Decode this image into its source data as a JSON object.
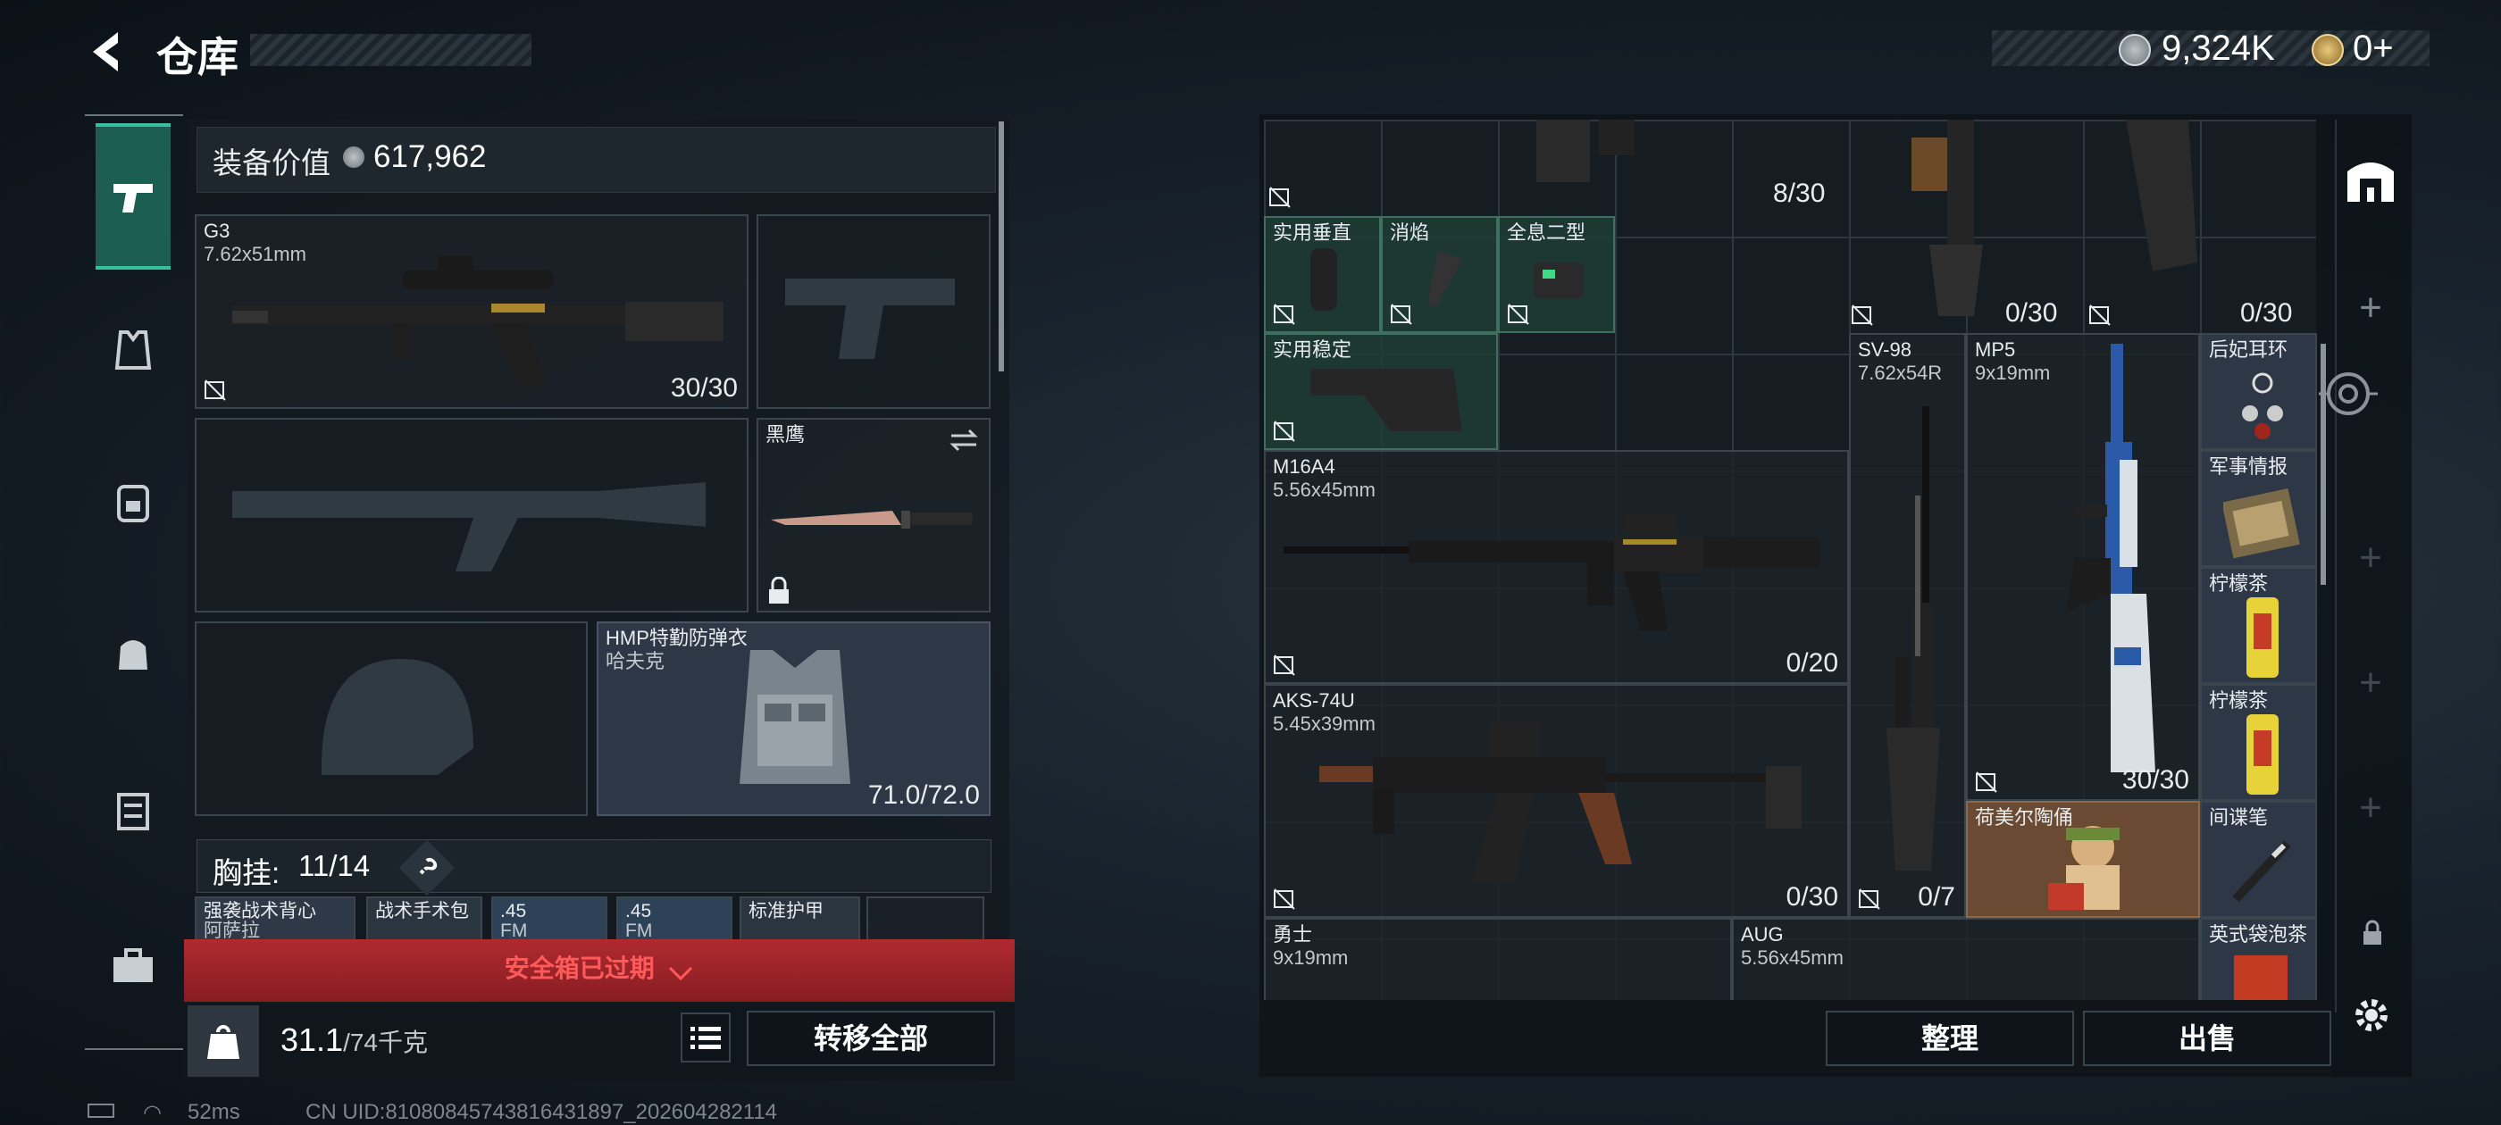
{
  "header": {
    "title": "仓库",
    "currency": "9,324K",
    "coins": "0+"
  },
  "equipment": {
    "value_label": "装备价值",
    "value": "617,962",
    "primary": {
      "name": "G3",
      "caliber": "7.62x51mm",
      "ammo": "30/30"
    },
    "melee": {
      "name": "黑鹰"
    },
    "armor": {
      "name": "HMP特勤防弹衣",
      "sub": "哈夫克",
      "durability": "71.0/72.0"
    },
    "chest": {
      "label": "胸挂:",
      "count": "11/14",
      "help": "?"
    },
    "chest_items": [
      "强袭战术背心",
      "战术手术包",
      ".45",
      ".45",
      "标准护甲"
    ],
    "chest_items_sub": [
      "阿萨拉",
      "",
      "FM",
      "FM",
      ""
    ],
    "safebox": "安全箱已过期",
    "weight": "31.1",
    "weight_max": "/74千克",
    "transfer_all": "转移全部"
  },
  "stash": {
    "items": [
      {
        "name": "实用垂直"
      },
      {
        "name": "消焰"
      },
      {
        "name": "全息二型"
      },
      {
        "name": "实用稳定"
      },
      {
        "name": "M16A4",
        "sub": "5.56x45mm",
        "ammo": "0/20"
      },
      {
        "name": "AKS-74U",
        "sub": "5.45x39mm",
        "ammo": "0/30"
      },
      {
        "name": "SV-98",
        "sub": "7.62x54R",
        "ammo": "0/7"
      },
      {
        "name": "MP5",
        "sub": "9x19mm",
        "ammo": "30/30"
      },
      {
        "name": "后妃耳环"
      },
      {
        "name": "军事情报"
      },
      {
        "name": "柠檬茶"
      },
      {
        "name": "柠檬茶"
      },
      {
        "name": "荷美尔陶俑"
      },
      {
        "name": "间谍笔"
      },
      {
        "name": "勇士",
        "sub": "9x19mm"
      },
      {
        "name": "AUG",
        "sub": "5.56x45mm"
      },
      {
        "name": "英式袋泡茶"
      }
    ],
    "top_ammo": [
      "8/30",
      "0/30",
      "0/30"
    ],
    "sort": "整理",
    "sell": "出售"
  },
  "status": {
    "ping": "52ms",
    "uid": "CN UID:8108084574381643189​7_202604282114"
  },
  "colors": {
    "accent_green": "#2e9e82",
    "alert_red": "#a0262c",
    "alert_text": "#ff4d4d",
    "panel": "#1c2228"
  }
}
